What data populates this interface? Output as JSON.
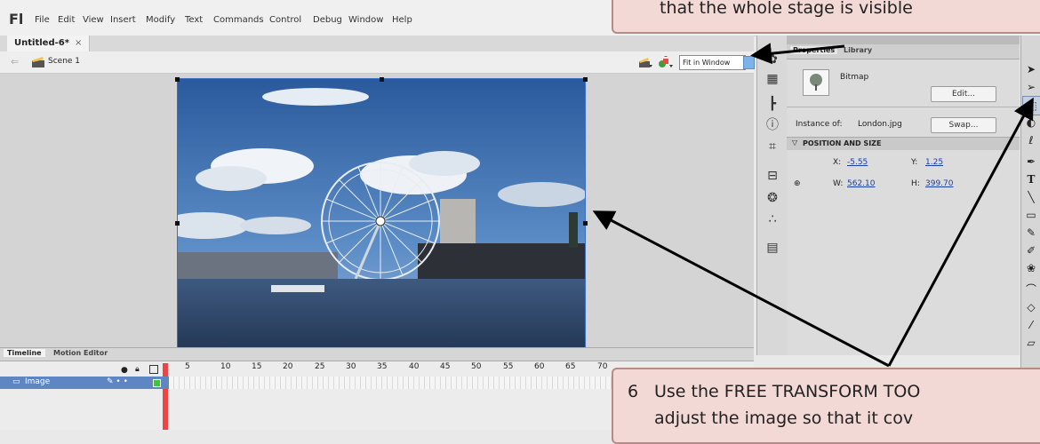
{
  "app": {
    "logo": "Fl"
  },
  "menus": [
    "File",
    "Edit",
    "View",
    "Insert",
    "Modify",
    "Text",
    "Commands",
    "Control",
    "Debug",
    "Window",
    "Help"
  ],
  "document_tab": {
    "title": "Untitled-6*",
    "close": "×"
  },
  "scene": {
    "name": "Scene 1",
    "zoom": "Fit in Window"
  },
  "properties": {
    "tabs": [
      "Properties",
      "Library"
    ],
    "type": "Bitmap",
    "edit_label": "Edit...",
    "instance_label": "Instance of:",
    "instance_value": "London.jpg",
    "swap_label": "Swap...",
    "section": "POSITION AND SIZE",
    "x_label": "X:",
    "x_value": "-5.55",
    "y_label": "Y:",
    "y_value": "1.25",
    "w_label": "W:",
    "w_value": "562.10",
    "h_label": "H:",
    "h_value": "399.70"
  },
  "timeline": {
    "tabs": [
      "Timeline",
      "Motion Editor"
    ],
    "layer": "Image",
    "frame_numbers": [
      "5",
      "10",
      "15",
      "20",
      "25",
      "30",
      "35",
      "40",
      "45",
      "50",
      "55",
      "60",
      "65",
      "70"
    ]
  },
  "callouts": {
    "top": "that the whole stage is visible",
    "bottom_num": "6",
    "bottom_line1": "Use the FREE TRANSFORM TOO",
    "bottom_line2": "adjust the image so that it cov"
  },
  "colors": {
    "selection": "#3b6fc4",
    "callout_bg": "#f3d9d5",
    "callout_border": "#b58b86"
  }
}
